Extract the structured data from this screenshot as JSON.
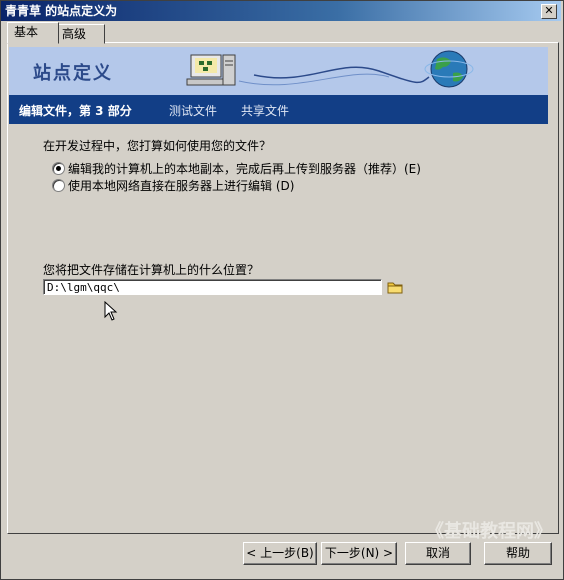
{
  "window": {
    "title": "青青草 的站点定义为",
    "close_label": "✕"
  },
  "tabs": [
    {
      "label": "基本"
    },
    {
      "label": "高级"
    }
  ],
  "banner": {
    "title": "站点定义"
  },
  "nav": {
    "step_current": "编辑文件，第 3 部分",
    "step_test": "测试文件",
    "step_share": "共享文件"
  },
  "question1": "在开发过程中，您打算如何使用您的文件？",
  "options": [
    {
      "label": "编辑我的计算机上的本地副本，完成后再上传到服务器（推荐）(E)",
      "selected": true
    },
    {
      "label": "使用本地网络直接在服务器上进行编辑 (D)",
      "selected": false
    }
  ],
  "question2": "您将把文件存储在计算机上的什么位置？",
  "path_value": "D:\\lgm\\qqc\\",
  "buttons": {
    "back": "< 上一步(B)",
    "next": "下一步(N) >",
    "cancel": "取消",
    "help": "帮助"
  },
  "watermark": "《基础教程网》",
  "colors": {
    "nav_bar": "#123e86",
    "banner_bg": "#b4c8ea",
    "title_bar": "#0a246a"
  },
  "icons": [
    "close-icon",
    "computer-icon",
    "globe-icon",
    "folder-icon",
    "mouse-cursor-icon"
  ]
}
